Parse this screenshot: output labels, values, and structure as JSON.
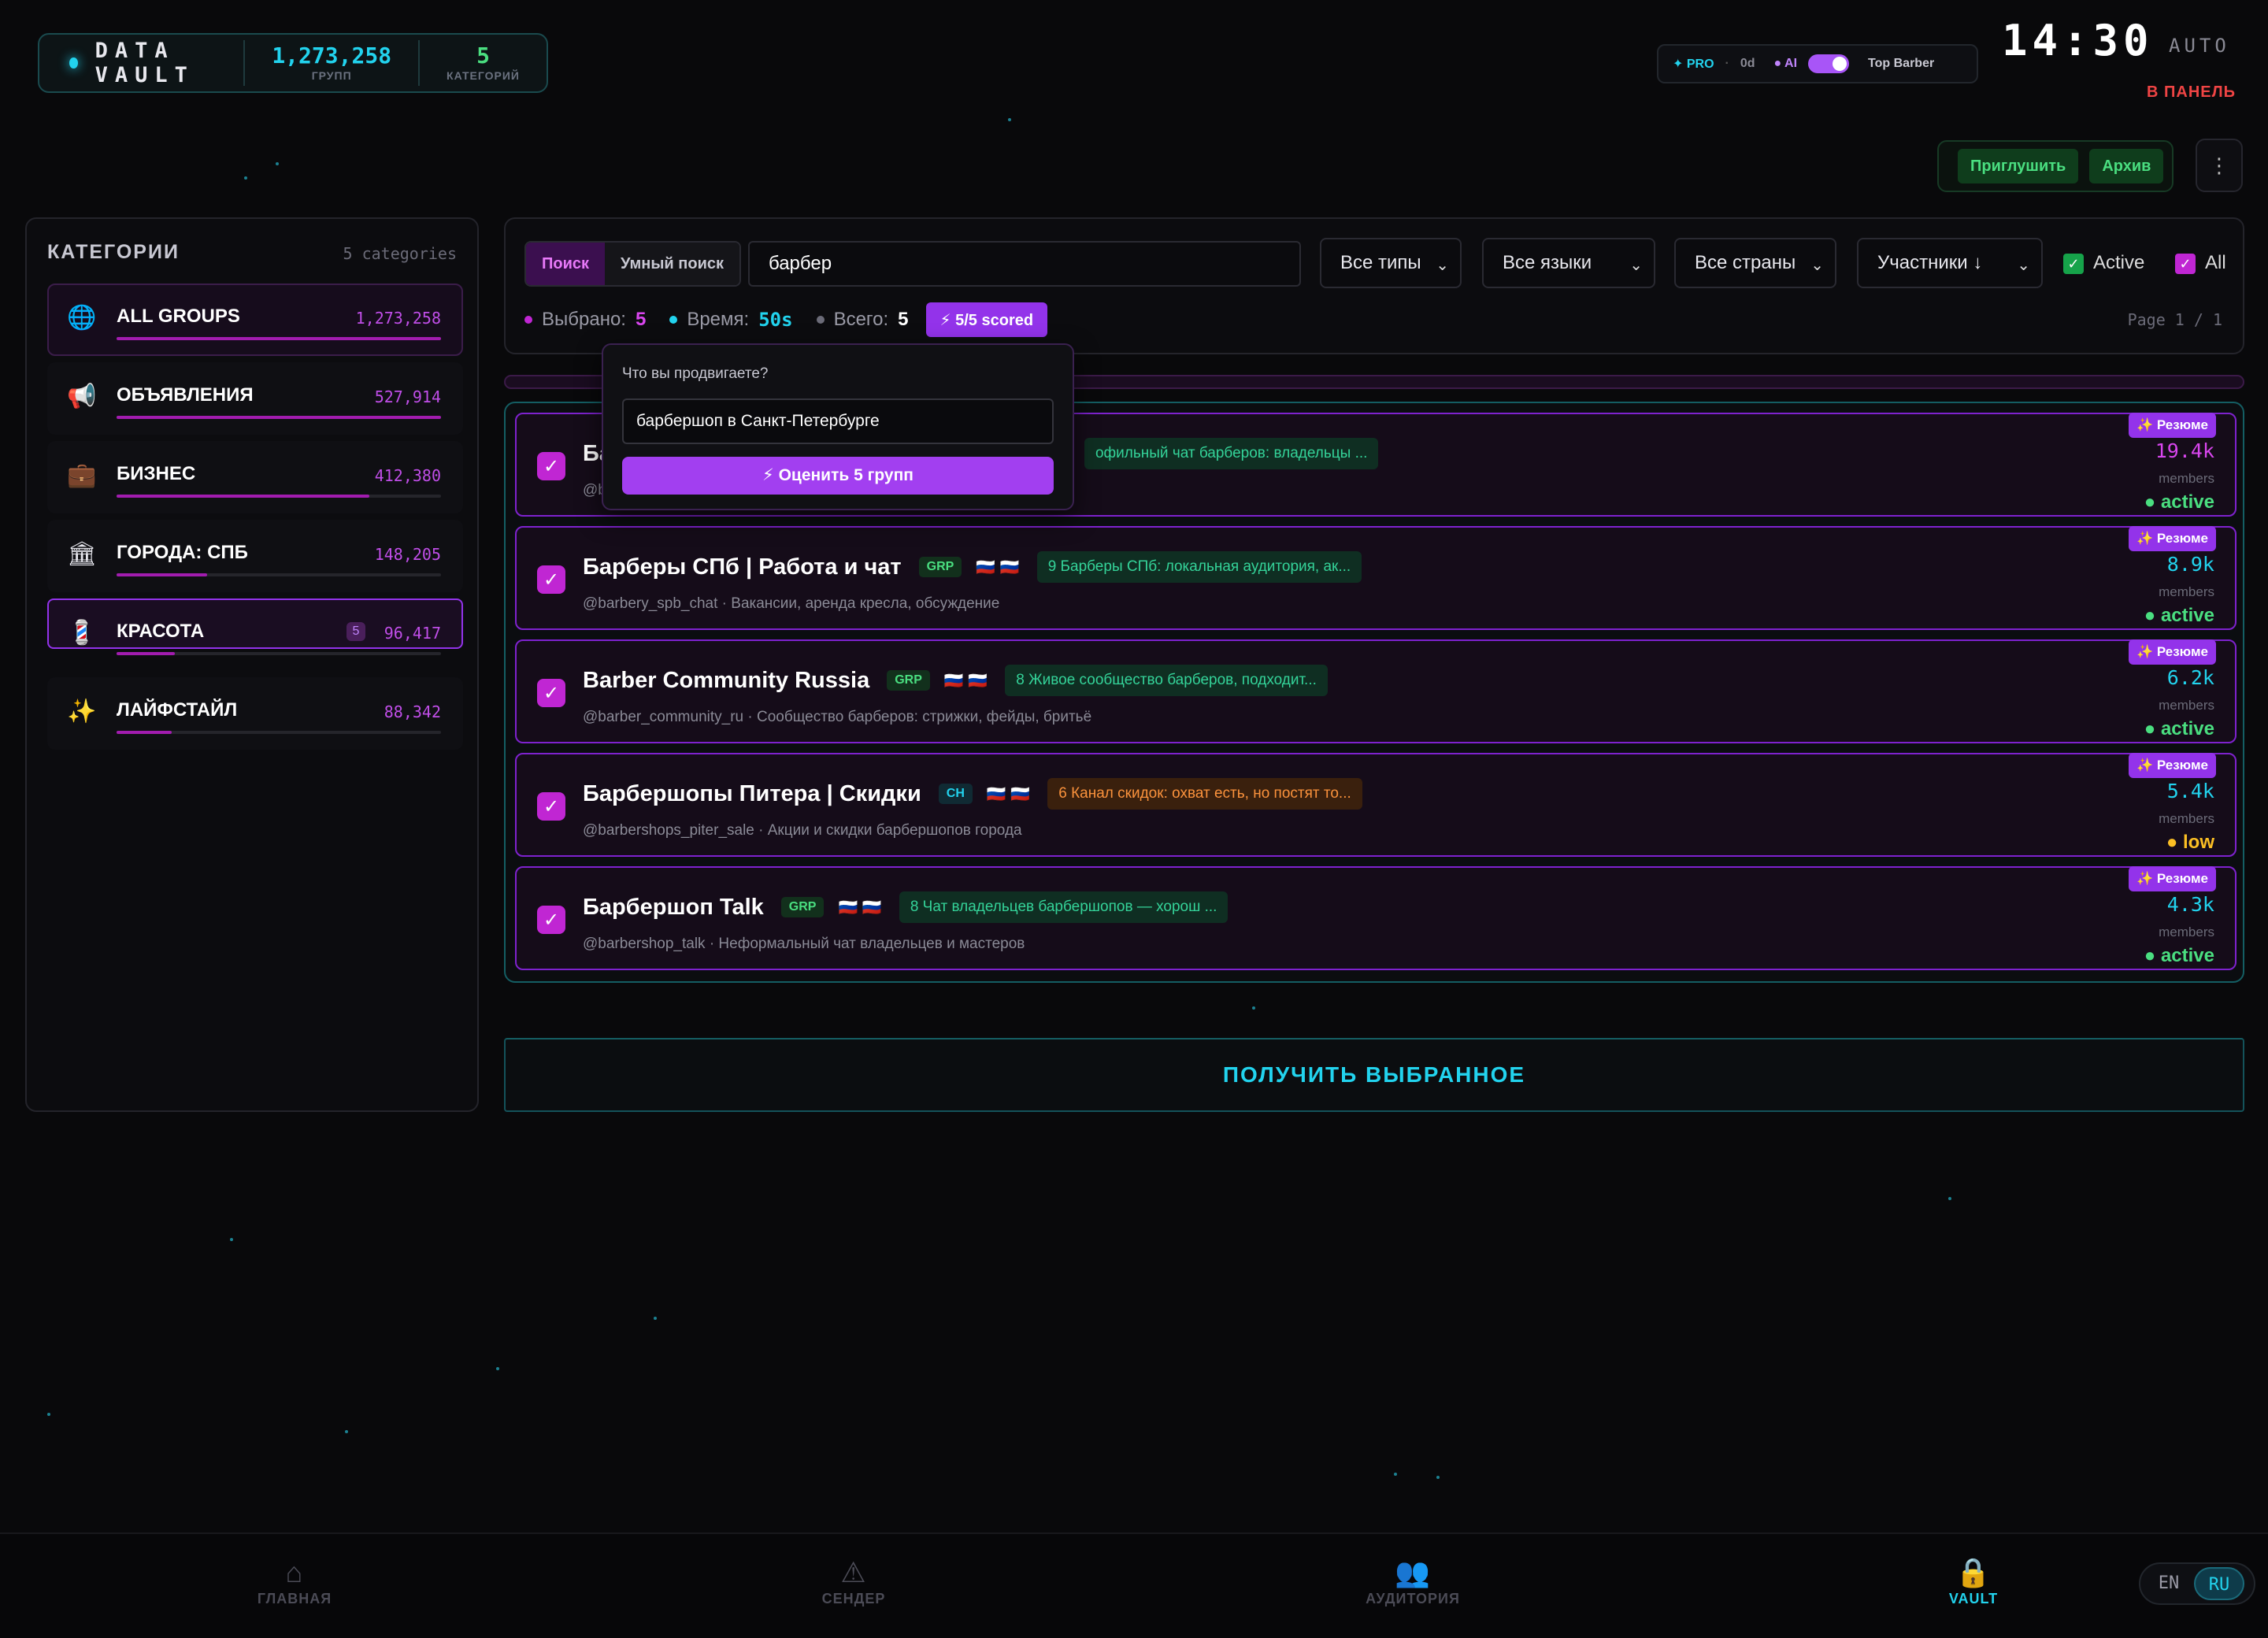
{
  "brand": {
    "name": "DATA VAULT",
    "groups_value": "1,273,258",
    "groups_label": "ГРУПП",
    "cats_value": "5",
    "cats_label": "КАТЕГОРИЙ"
  },
  "status": {
    "pro": "✦ PRO",
    "sep": "·",
    "days": "0d",
    "ai": "● AI",
    "title": "Top Barber"
  },
  "clock": {
    "time": "14:30",
    "mode": "AUTO",
    "panel": "В ПАНЕЛЬ"
  },
  "actions": {
    "mute": "Приглушить",
    "archive": "Архив",
    "more": "⋮"
  },
  "sidebar": {
    "title": "КАТЕГОРИИ",
    "count": "5 categories",
    "items": [
      {
        "icon": "🌐",
        "label": "ALL GROUPS",
        "value": "1,273,258",
        "fill": 1.0
      },
      {
        "icon": "📢",
        "label": "ОБЪЯВЛЕНИЯ",
        "value": "527,914",
        "fill": 1.0
      },
      {
        "icon": "💼",
        "label": "БИЗНЕС",
        "value": "412,380",
        "fill": 0.78
      },
      {
        "icon": "🏛",
        "label": "ГОРОДА: СПБ",
        "value": "148,205",
        "fill": 0.28
      },
      {
        "icon": "💈",
        "label": "КРАСОТА",
        "value": "96,417",
        "badge": "5",
        "fill": 0.18
      },
      {
        "icon": "✨",
        "label": "ЛАЙФСТАЙЛ",
        "value": "88,342",
        "fill": 0.17
      }
    ]
  },
  "search": {
    "mode_search": "Поиск",
    "mode_smart": "Умный поиск",
    "query": "барбер",
    "filter_types": "Все типы",
    "filter_langs": "Все языки",
    "filter_countries": "Все страны",
    "sort": "Участники ↓",
    "active_label": "Active",
    "all_label": "All",
    "chev": "⌄",
    "check": "✓"
  },
  "stats": {
    "selected_label": "Выбрано:",
    "selected_value": "5",
    "time_label": "Время:",
    "time_value": "50s",
    "total_label": "Всего:",
    "total_value": "5",
    "scored": "⚡ 5/5 scored",
    "page": "Page 1 / 1"
  },
  "popup": {
    "question": "Что вы продвигаете?",
    "value": "барбершоп в Санкт-Петербурге",
    "button": "⚡  Оценить 5 групп"
  },
  "rows": [
    {
      "name": "Ба",
      "tag": "",
      "flags": "",
      "score": "офильный чат барберов: владельцы ...",
      "sub": "@b",
      "resume": "✨ Резюме",
      "members": "19.4k",
      "members_label": "members",
      "status": "● active"
    },
    {
      "name": "Барберы СПб | Работа и чат",
      "tag": "GRP",
      "flags": "🇷🇺 🇷🇺",
      "score": "9 Барберы СПб: локальная аудитория, ак...",
      "sub": "@barbery_spb_chat · Вакансии, аренда кресла, обсуждение",
      "resume": "✨ Резюме",
      "members": "8.9k",
      "members_label": "members",
      "status": "● active"
    },
    {
      "name": "Barber Community Russia",
      "tag": "GRP",
      "flags": "🇷🇺 🇷🇺",
      "score": "8 Живое сообщество барберов, подходит...",
      "sub": "@barber_community_ru · Сообщество барберов: стрижки, фейды, бритьё",
      "resume": "✨ Резюме",
      "members": "6.2k",
      "members_label": "members",
      "status": "● active"
    },
    {
      "name": "Барбершопы Питера | Скидки",
      "tag": "CH",
      "flags": "🇷🇺 🇷🇺",
      "score": "6 Канал скидок: охват есть, но постят то...",
      "sub": "@barbershops_piter_sale · Акции и скидки барбершопов города",
      "resume": "✨ Резюме",
      "members": "5.4k",
      "members_label": "members",
      "status": "● low"
    },
    {
      "name": "Барбершоп Talk",
      "tag": "GRP",
      "flags": "🇷🇺 🇷🇺",
      "score": "8 Чат владельцев барбершопов — хорош ...",
      "sub": "@barbershop_talk · Неформальный чат владельцев и мастеров",
      "resume": "✨ Резюме",
      "members": "4.3k",
      "members_label": "members",
      "status": "● active"
    }
  ],
  "get_selected": "ПОЛУЧИТЬ ВЫБРАННОЕ",
  "nav": [
    {
      "icon": "⌂",
      "label": "ГЛАВНАЯ"
    },
    {
      "icon": "⚠",
      "label": "СЕНДЕР"
    },
    {
      "icon": "👥",
      "label": "АУДИТОРИЯ"
    },
    {
      "icon": "🔒",
      "label": "VAULT"
    }
  ],
  "lang": {
    "en": "EN",
    "ru": "RU"
  },
  "colors": {
    "accent": "#22d3ee",
    "purple": "#9333ea",
    "green": "#4ade80",
    "warn": "#fbbf24"
  }
}
